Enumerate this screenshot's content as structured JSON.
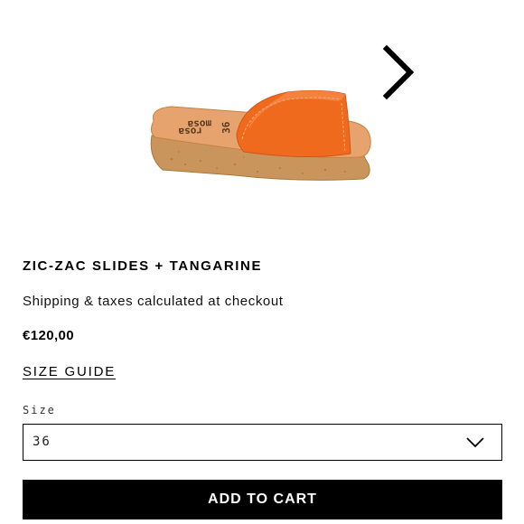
{
  "product": {
    "title": "ZIC-ZAC SLIDES + TANGARINE",
    "shipping_note": "Shipping & taxes calculated at checkout",
    "price": "€120,00",
    "image_icon": "product-photo-orange-slide-sandal",
    "image_insole_print": "rosa mosa 36"
  },
  "gallery": {
    "next_icon": "chevron-right-icon"
  },
  "size_guide": {
    "label": "SIZE GUIDE"
  },
  "size_selector": {
    "label": "Size",
    "selected": "36",
    "icon": "chevron-down-icon"
  },
  "cart": {
    "add_label": "ADD TO CART"
  },
  "colors": {
    "upper": "#f06a1e",
    "insole": "#e6a36d",
    "cork": "#c9955c",
    "button_bg": "#000000",
    "button_text": "#ffffff"
  }
}
